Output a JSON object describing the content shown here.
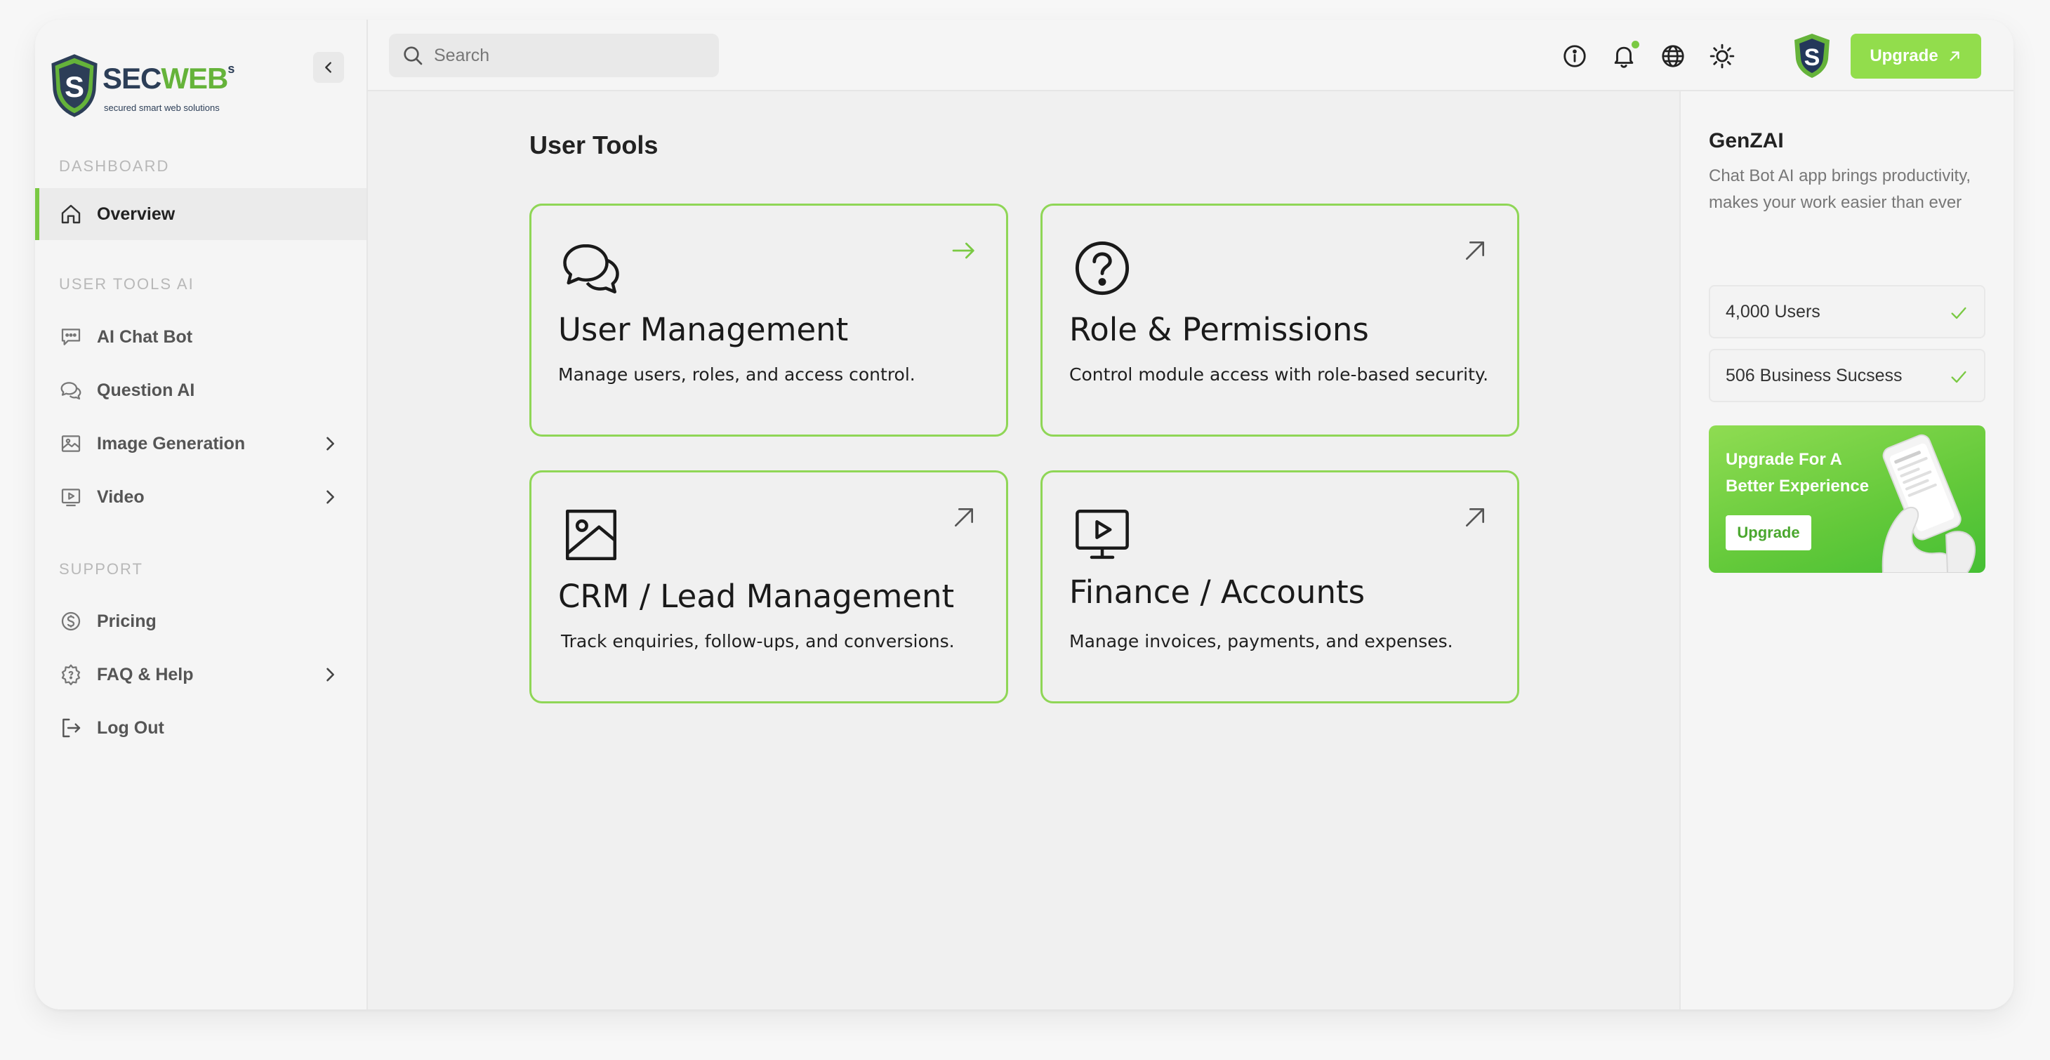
{
  "brand": {
    "name_part1": "SEC",
    "name_part2": "WEB",
    "name_sup": "s",
    "tagline": "secured smart web solutions"
  },
  "sidebar": {
    "sections": [
      {
        "label": "DASHBOARD",
        "items": [
          {
            "label": "Overview",
            "icon": "home-icon",
            "active": true
          }
        ]
      },
      {
        "label": "USER TOOLS AI",
        "items": [
          {
            "label": "AI Chat Bot",
            "icon": "chat-bot-icon"
          },
          {
            "label": "Question AI",
            "icon": "chat-bubbles-icon"
          },
          {
            "label": "Image Generation",
            "icon": "images-icon",
            "has_submenu": true
          },
          {
            "label": "Video",
            "icon": "video-icon",
            "has_submenu": true
          }
        ]
      },
      {
        "label": "SUPPORT",
        "items": [
          {
            "label": "Pricing",
            "icon": "dollar-icon"
          },
          {
            "label": "FAQ & Help",
            "icon": "gear-help-icon",
            "has_submenu": true
          },
          {
            "label": "Log Out",
            "icon": "logout-icon"
          }
        ]
      }
    ]
  },
  "topbar": {
    "search_placeholder": "Search",
    "icons": [
      "info-icon",
      "bell-icon",
      "globe-icon",
      "sun-icon"
    ],
    "upgrade_label": "Upgrade"
  },
  "main": {
    "title": "User Tools",
    "cards": [
      {
        "title": "User Management",
        "description": "Manage users, roles, and access control.",
        "icon": "chat-bubbles-icon",
        "corner": "arrow-right-icon"
      },
      {
        "title": "Role & Permissions",
        "description": "Control module access with role-based security.",
        "icon": "question-circle-icon",
        "corner": "arrow-up-right-icon"
      },
      {
        "title": "CRM / Lead Management",
        "description": "Track enquiries, follow-ups, and conversions.",
        "icon": "image-icon",
        "corner": "arrow-up-right-icon"
      },
      {
        "title": "Finance / Accounts",
        "description": "Manage invoices, payments, and expenses.",
        "icon": "monitor-play-icon",
        "corner": "arrow-up-right-icon"
      }
    ]
  },
  "right_panel": {
    "title": "GenZAI",
    "description": "Chat Bot AI app brings productivity, makes your work easier than ever",
    "stats": [
      {
        "label": "4,000 Users"
      },
      {
        "label": "506 Business Sucsess"
      }
    ],
    "promo": {
      "text": "Upgrade For A Better Experience",
      "button": "Upgrade"
    }
  },
  "colors": {
    "accent": "#7ac943",
    "card_border": "#8fd656",
    "upgrade_button": "#92dd4c",
    "logo_dark": "#2c3e57"
  }
}
